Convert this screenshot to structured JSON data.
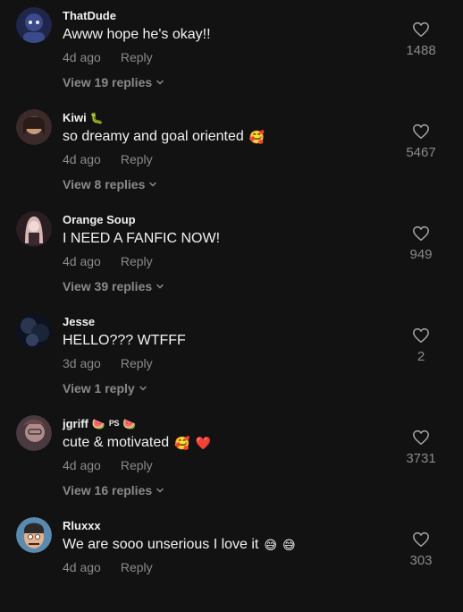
{
  "comments": [
    {
      "username": "ThatDude",
      "text": "Awww hope he's okay!!",
      "emojis": [],
      "time": "4d ago",
      "reply_label": "Reply",
      "view_replies": "View 19 replies",
      "likes": "1488",
      "avatar_colors": [
        "#3a4a8a",
        "#20264a"
      ]
    },
    {
      "username": "Kiwi",
      "badges": [
        "🐛"
      ],
      "text": "so dreamy and goal oriented",
      "emojis": [
        "🥰"
      ],
      "time": "4d ago",
      "reply_label": "Reply",
      "view_replies": "View 8 replies",
      "likes": "5467",
      "avatar_colors": [
        "#c99a7a",
        "#3a2a2a"
      ]
    },
    {
      "username": "Orange Soup",
      "text": "I NEED A FANFIC NOW!",
      "emojis": [],
      "time": "4d ago",
      "reply_label": "Reply",
      "view_replies": "View 39 replies",
      "likes": "949",
      "avatar_colors": [
        "#d8b6b6",
        "#2a1e22"
      ]
    },
    {
      "username": "Jesse",
      "text": "HELLO??? WTFFF",
      "emojis": [],
      "time": "3d ago",
      "reply_label": "Reply",
      "view_replies": "View 1 reply",
      "likes": "2",
      "avatar_colors": [
        "#2a3550",
        "#0e1220"
      ]
    },
    {
      "username": "jgriff",
      "badges": [
        "🍉",
        "PS",
        "🍉"
      ],
      "text": "cute & motivated",
      "emojis": [
        "🥰",
        "❤️"
      ],
      "time": "4d ago",
      "reply_label": "Reply",
      "view_replies": "View 16 replies",
      "likes": "3731",
      "avatar_colors": [
        "#b08a8a",
        "#4a3a40"
      ]
    },
    {
      "username": "Rluxxx",
      "text": "We are sooo unserious I love it",
      "emojis": [
        "😅",
        "😅"
      ],
      "time": "4d ago",
      "reply_label": "Reply",
      "view_replies": "",
      "likes": "303",
      "avatar_colors": [
        "#e6b08a",
        "#5a8ab0"
      ]
    }
  ],
  "icons": {
    "like": "heart-outline-icon",
    "expand": "chevron-down-icon"
  },
  "colors": {
    "background": "#121212",
    "text_primary": "#f2f2f2",
    "text_secondary": "#8a8a8a"
  }
}
